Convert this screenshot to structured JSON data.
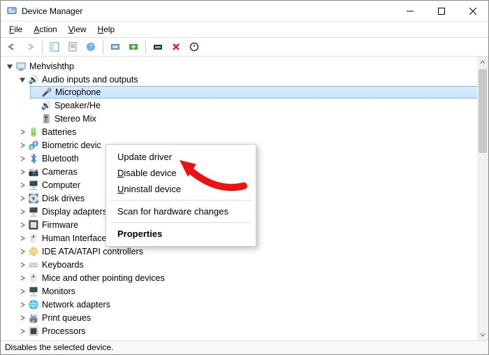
{
  "window": {
    "title": "Device Manager"
  },
  "menu": {
    "file": "File",
    "action": "Action",
    "view": "View",
    "help": "Help"
  },
  "tree": {
    "root": "Mehvishthp",
    "audio": {
      "label": "Audio inputs and outputs",
      "mic": "Microphone",
      "spk": "Speaker/He",
      "mix": "Stereo Mix"
    },
    "batteries": "Batteries",
    "biometric": "Biometric devic",
    "bluetooth": "Bluetooth",
    "cameras": "Cameras",
    "computer": "Computer",
    "disk": "Disk drives",
    "display": "Display adapters",
    "firmware": "Firmware",
    "hid": "Human Interface Devices",
    "ide": "IDE ATA/ATAPI controllers",
    "keyboards": "Keyboards",
    "mice": "Mice and other pointing devices",
    "monitors": "Monitors",
    "network": "Network adapters",
    "print": "Print queues",
    "processors": "Processors"
  },
  "context_menu": {
    "update": "Update driver",
    "disable_pre": "D",
    "disable_mid": "isable device",
    "uninstall_pre": "U",
    "uninstall_mid": "ninstall device",
    "scan": "Scan for hardware changes",
    "properties": "Properties"
  },
  "status": "Disables the selected device."
}
